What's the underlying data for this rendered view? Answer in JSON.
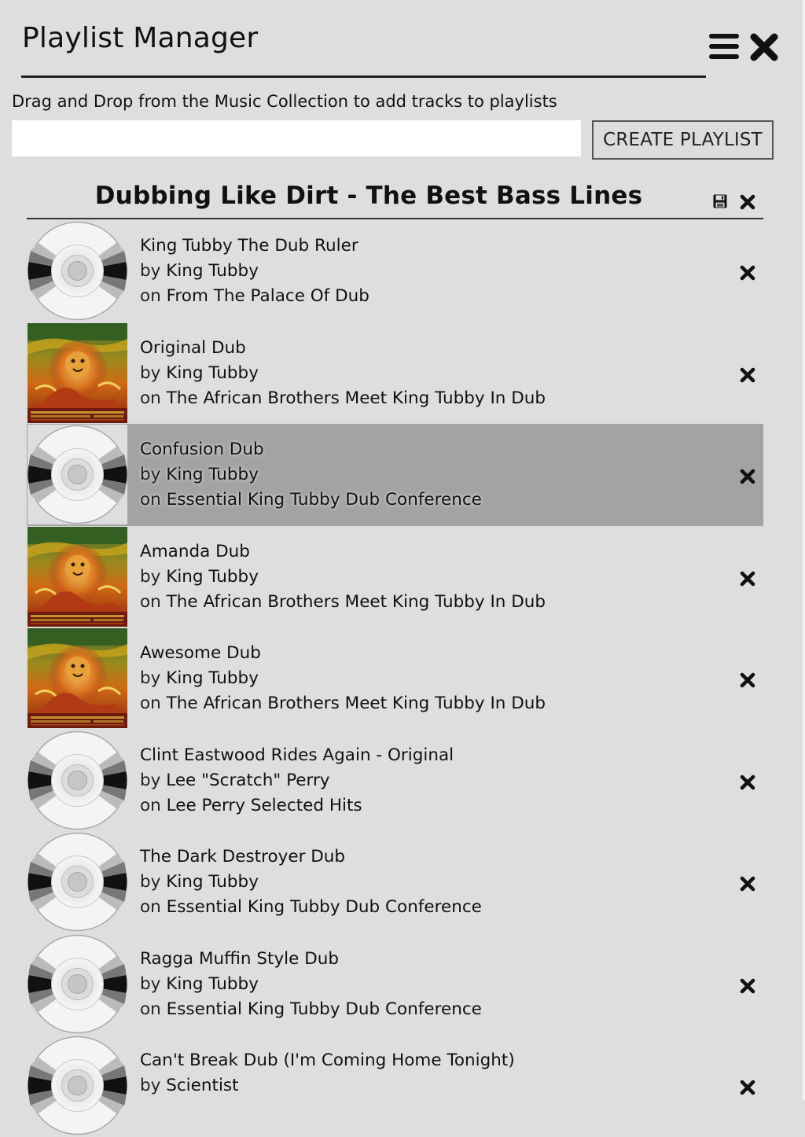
{
  "header": {
    "title": "Playlist Manager"
  },
  "creator": {
    "hint": "Drag and Drop from the Music Collection to add tracks to playlists",
    "name_value": "",
    "name_placeholder": "",
    "create_label": "CREATE PLAYLIST"
  },
  "playlist": {
    "title": "Dubbing Like Dirt - The Best Bass Lines",
    "by_prefix": "by",
    "on_prefix": "on",
    "tracks": [
      {
        "title": "King Tubby The Dub Ruler",
        "artist": "King Tubby",
        "album": "From The Palace Of Dub",
        "art": "cd-placeholder",
        "selected": false
      },
      {
        "title": "Original Dub",
        "artist": "King Tubby",
        "album": "The African Brothers Meet King Tubby In Dub",
        "art": "album-cover",
        "selected": false
      },
      {
        "title": "Confusion Dub",
        "artist": "King Tubby",
        "album": "Essential King Tubby Dub Conference",
        "art": "cd-placeholder",
        "selected": true
      },
      {
        "title": "Amanda Dub",
        "artist": "King Tubby",
        "album": "The African Brothers Meet King Tubby In Dub",
        "art": "album-cover",
        "selected": false
      },
      {
        "title": "Awesome Dub",
        "artist": "King Tubby",
        "album": "The African Brothers Meet King Tubby In Dub",
        "art": "album-cover",
        "selected": false
      },
      {
        "title": "Clint Eastwood Rides Again - Original",
        "artist": "Lee \"Scratch\" Perry",
        "album": "Lee Perry Selected Hits",
        "art": "cd-placeholder",
        "selected": false
      },
      {
        "title": "The Dark Destroyer Dub",
        "artist": "King Tubby",
        "album": "Essential King Tubby Dub Conference",
        "art": "cd-placeholder",
        "selected": false
      },
      {
        "title": "Ragga Muffin Style Dub",
        "artist": "King Tubby",
        "album": "Essential King Tubby Dub Conference",
        "art": "cd-placeholder",
        "selected": false
      },
      {
        "title": "Can't Break Dub (I'm Coming Home Tonight)",
        "artist": "Scientist",
        "album": "",
        "art": "cd-placeholder",
        "selected": false
      }
    ]
  },
  "icons": {
    "menu": "hamburger-icon",
    "close": "close-icon",
    "save": "floppy-disk-icon",
    "remove": "remove-x-icon"
  },
  "colors": {
    "background": "#dedede",
    "selected_row": "#a3a3a3",
    "text": "#111111"
  }
}
